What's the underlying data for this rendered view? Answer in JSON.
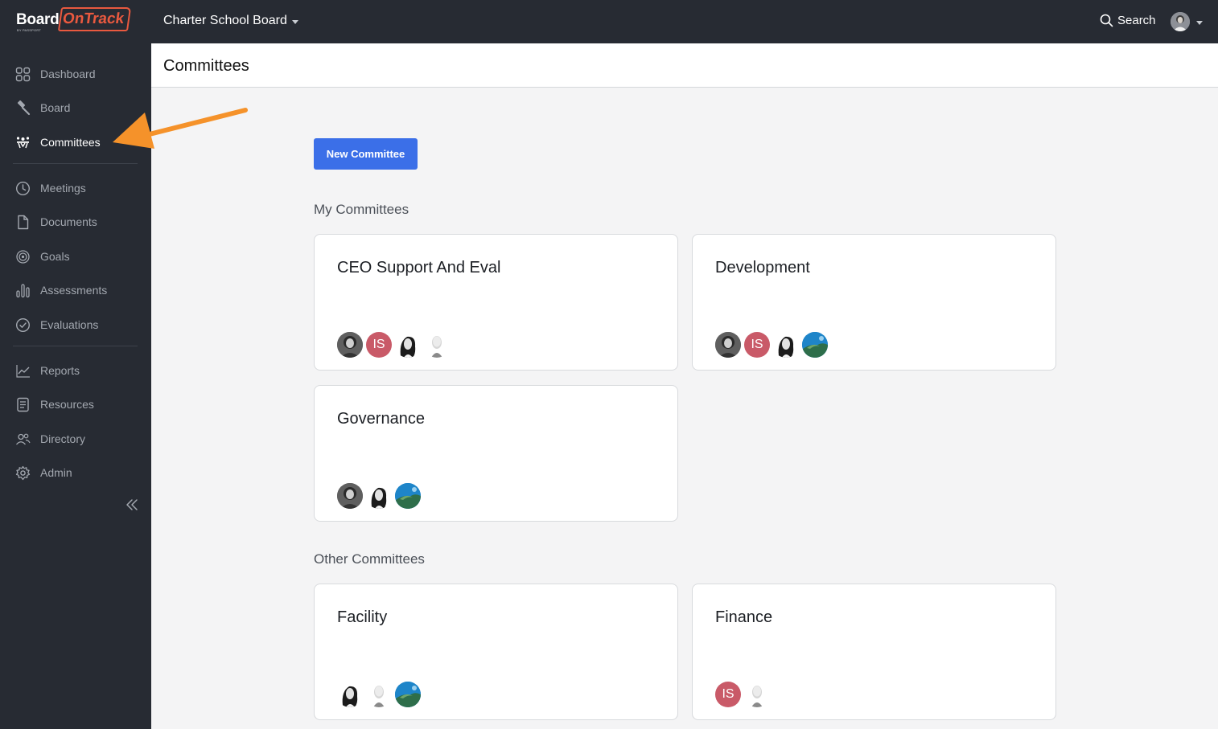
{
  "app": {
    "logo_primary": "Board",
    "logo_secondary": "OnTrack",
    "logo_tagline": "BY PASSPORT",
    "org_name": "Charter School Board",
    "search_label": "Search"
  },
  "sidebar": {
    "items": [
      {
        "label": "Dashboard",
        "icon": "grid-icon"
      },
      {
        "label": "Board",
        "icon": "gavel-icon"
      },
      {
        "label": "Committees",
        "icon": "committee-icon",
        "active": true
      },
      {
        "label": "Meetings",
        "icon": "clock-icon"
      },
      {
        "label": "Documents",
        "icon": "document-icon"
      },
      {
        "label": "Goals",
        "icon": "target-icon"
      },
      {
        "label": "Assessments",
        "icon": "bar-chart-icon"
      },
      {
        "label": "Evaluations",
        "icon": "check-circle-icon"
      },
      {
        "label": "Reports",
        "icon": "line-chart-icon"
      },
      {
        "label": "Resources",
        "icon": "list-document-icon"
      },
      {
        "label": "Directory",
        "icon": "people-icon"
      },
      {
        "label": "Admin",
        "icon": "gear-icon"
      }
    ]
  },
  "page": {
    "title": "Committees",
    "new_button": "New Committee",
    "my_section": "My Committees",
    "other_section": "Other Committees"
  },
  "my_committees": [
    {
      "name": "CEO Support And Eval",
      "members": [
        "photo-dark",
        "initials:IS",
        "photo-bw",
        "photo-bald"
      ]
    },
    {
      "name": "Development",
      "members": [
        "photo-dark",
        "initials:IS",
        "photo-bw",
        "photo-nature"
      ]
    },
    {
      "name": "Governance",
      "members": [
        "photo-dark",
        "photo-bw",
        "photo-nature"
      ]
    }
  ],
  "other_committees": [
    {
      "name": "Facility",
      "members": [
        "photo-bw",
        "photo-bald",
        "photo-nature"
      ]
    },
    {
      "name": "Finance",
      "members": [
        "initials:IS",
        "photo-bald"
      ]
    }
  ],
  "colors": {
    "sidebar_bg": "#272b33",
    "accent": "#3b6fe8",
    "brand": "#e9593f",
    "annotation_arrow": "#f5922a",
    "initials_avatar": "#c95a68"
  }
}
